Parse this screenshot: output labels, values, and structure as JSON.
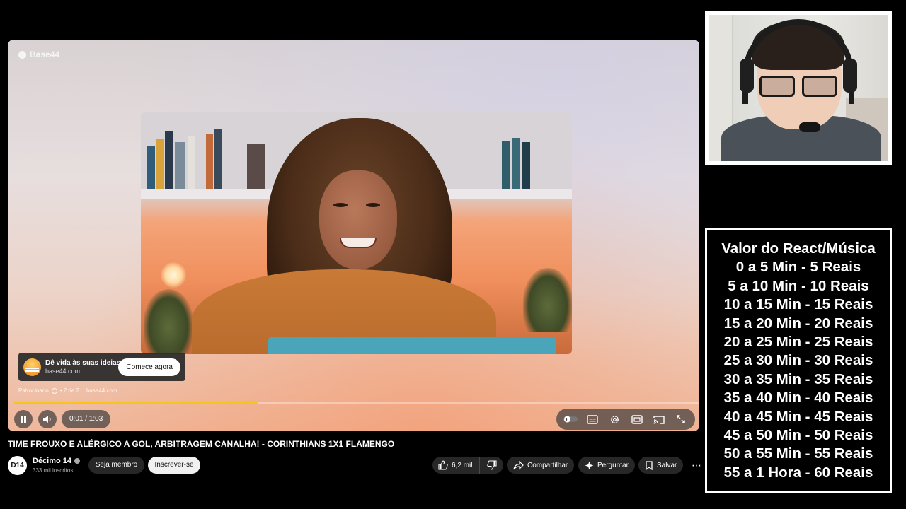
{
  "player": {
    "watermark": "Base44",
    "ad": {
      "title": "Dê vida às suas ideias",
      "domain": "base44.com",
      "cta": "Comece agora",
      "sponsored_label": "Patrocinado",
      "ad_position": "• 2 de 2",
      "sponsor_url": "base44.com"
    },
    "progress_fraction": 0.355,
    "progress_color": "#f5c518",
    "time": "0:01 / 1:03",
    "controls": [
      "pause-icon",
      "volume-icon",
      "autoplay-toggle-icon",
      "subtitles-icon",
      "settings-gear-icon",
      "theater-mode-icon",
      "cast-icon",
      "fullscreen-icon"
    ]
  },
  "video": {
    "title": "TIME FROUXO E ALÉRGICO A GOL, ARBITRAGEM CANALHA! - CORINTHIANS 1X1 FLAMENGO"
  },
  "channel": {
    "avatar_text": "D14",
    "name": "Décimo 14",
    "subscribers": "333 mil inscritos",
    "join_label": "Seja membro",
    "subscribe_label": "Inscrever-se"
  },
  "actions": {
    "likes": "6,2 mil",
    "share_label": "Compartilhar",
    "ask_label": "Perguntar",
    "save_label": "Salvar",
    "more_label": "⋯"
  },
  "price_box": {
    "lines": [
      "Valor do React/Música",
      "0 a 5 Min - 5 Reais",
      "5 a 10 Min - 10 Reais",
      "10 a 15 Min - 15 Reais",
      "15 a 20 Min - 20 Reais",
      "20 a 25 Min - 25 Reais",
      "25 a 30 Min - 30 Reais",
      "30 a 35 Min - 35 Reais",
      "35 a 40 Min - 40 Reais",
      "40 a 45 Min - 45 Reais",
      "45 a 50 Min - 50 Reais",
      "50 a 55 Min - 55 Reais",
      "55 a 1 Hora - 60 Reais"
    ]
  }
}
